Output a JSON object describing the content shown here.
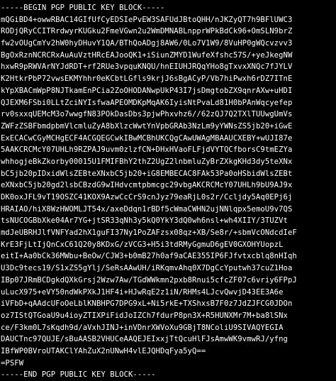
{
  "window": {
    "background": "#000000",
    "text_color": "#ffffff"
  },
  "pgp_block": {
    "begin": "-----BEGIN PGP PUBLIC KEY BLOCK-----",
    "lines": [
      "mQGiBD4+owwRBAC14GIfUfCyEDSIePvEW3SAFUdJBtoQHH/nJKZyQT7h9BFlUWC3",
      "RODjQRyCCITRrdwyrKUGku2FmeVGwn2u2WmDMNABLnpprWPkBdCk96+OmSLN9brZ",
      "fw2vOUgCmYv2hW0hyDHuvY1QA/BThQoADgj8AW6/0Lo7V1W9/8VuHP0gWQcvzvv3",
      "BgOxRznNCRCRxAuAuVztHRcEAJooQK1+iSiunZMYD1WufeXfshc57S/+yeJkegNW",
      "hxwR9pRWVArNYJdRDT+rf2RUe3vpquKNQU/hnEIUHJRQqYHo8gTxvxXNQc7fJYLV",
      "K2HtkrPbP72vwsEKMYhhr0eKCbtLGfls9krjJ6sBgACyP/Vb7hiPwxh6rDZ7ITnE",
      "kYpXBACmWpP8NJTkamEnPCia2ZoOHODANwpUkP43I7jsDmgtobZX9qnrAXw+uHDI",
      "QJEXM6FSbi0LLtZciNYIsfwaAPEOMDKpMqAK6IyisNtPvaLd81H0bPAnWqcyefep",
      "rv0sxxqUEMcM3o7wwgfN83POkDasDbs3pjwPhxvhz6//62zQJ7Q2TXlTUUwgUmVs",
      "ZWFzZSBFbmdpbmVlcmluZyA8bXlzcWwtYnVpbGRAb3NzLm9yYWNsZS5jb20+iGwE",
      "ExECACwCGyMCHgECF4ACGQEGCwkIBwMCBhUKCQgCAwUWAgMBAAUCXEBY+wUJI87e",
      "5AAKCRCMcY07UHLh9RZPAJ9uvm0zlzfCN+DHxHVaoFLFjdVYTQCfborsC9tmEZYa",
      "whhogjeBkZkorby00015U1FMIFBhY2thZ2UgZ2lnbmluZyBrZXkgKHd3dy5teXNx",
      "bC5jb20pIDxidWlsZEBteXNxbC5jb20+iG8EMBECAC8FAk53Pa0oHSbidWlsZEBt",
      "eXNxbC5jb20gd2lsbCBzdG9wIHdvcmtpbmcgc29vbgAKCRCMcY07UHLh9bU9AJ9x",
      "DK0oxJFL9vT19OSZC41KOX9AzwCcCrS9cnJyz79eaRjL0s2r/Ccljdy5Aq0EPj6j",
      "HRAIAO/hiX8WzHWOMLJT54x/axeDdqn1rBDf5cWmaCWHN2ujNNlqpx5emoU9v7QS",
      "tsNUCOGBbXke04Ar7YG+jtSR33qNh3y5kQ0YkY3dQ0wh6nsl+wh4XIIY/3TUZVt",
      "mdJeUBRHJlfVNFYad2hX1guFI37Ny1PoZAFzsx08qz+XB/Se8r/+sbmVcONdcdIeF",
      "KrE3FjLtIjQnCxC61Q20y8KDxG/zVCG3+H5i3tdRMyGgmuD6gEV0GXOHYUopzL",
      "eitI+Aa0bCk36MWbu+BeOw/CJW3+b0mB27h0af9aCAE355IP6FJfvtxcblq8nHIqh",
      "U3Dc9tecs19/S1xZS5gYlj/SeRsAAwUH/iRKqmvAhq0X7DgCcYputwh37cuZ1Hoa",
      "IBp07JRmBCDgkdQXkGrsj2Wzw7Aw/TGdWWkmn2pxb8Rnui5cfcZF07c6vriy6FPpJ",
      "uLucX975+eVY50ndWkPXkJ1HF4i+HJwRqE2z1iN/RHMs4LJcvQwvjD43EE3A6e",
      "iVFbD+qAAdcUFoOeLblKNBHPG7DPG9xL+Ni5rkE+TXShxsB7F0z7JdZJFCG0JDOn",
      "oz7IStQTGoaU9u4ioyZTIXPiFidJoIZCh7fdurP8pn3X+R5HUNXMr7M+ba8lSNx",
      "ce/F3km0L7sKqdh9d/aVxhJINJ+inVDnrXWVoXu9GBjT8NColiU9SIVAQYEGIA",
      "DAUCTnc97QUJE/sBuAASB2VHUCeAAQEJEIxxjTtQcuHlFJsAmwWK9vmwRJ/yfng",
      "IBfWP0BVroUTAKClYAhZuX2nUNwH4vlEJQHDqFya5yQ==",
      "=PSFW"
    ],
    "end": "-----END PGP PUBLIC KEY BLOCK-----"
  }
}
